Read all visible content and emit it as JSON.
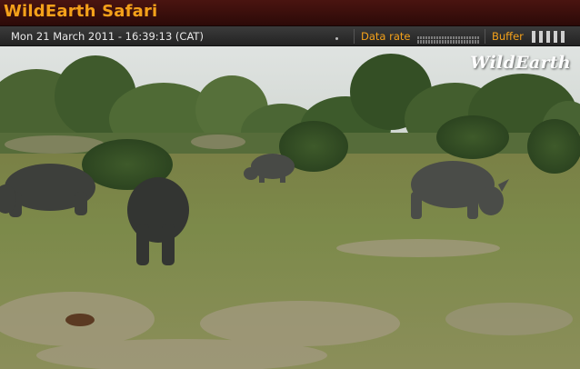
{
  "app": {
    "title": "WildEarth Safari"
  },
  "status": {
    "datetime": "Mon 21 March 2011 - 16:39:13 (CAT)",
    "data_rate_label": "Data rate",
    "buffer_label": "Buffer",
    "buffer_bars": 5
  },
  "video": {
    "watermark": "WildEarth",
    "scene_icon": "rhino-herd-scene"
  },
  "colors": {
    "accent": "#f4a11a",
    "titlebar": "#3a0f0c",
    "statusbar": "#2e2e2e"
  }
}
